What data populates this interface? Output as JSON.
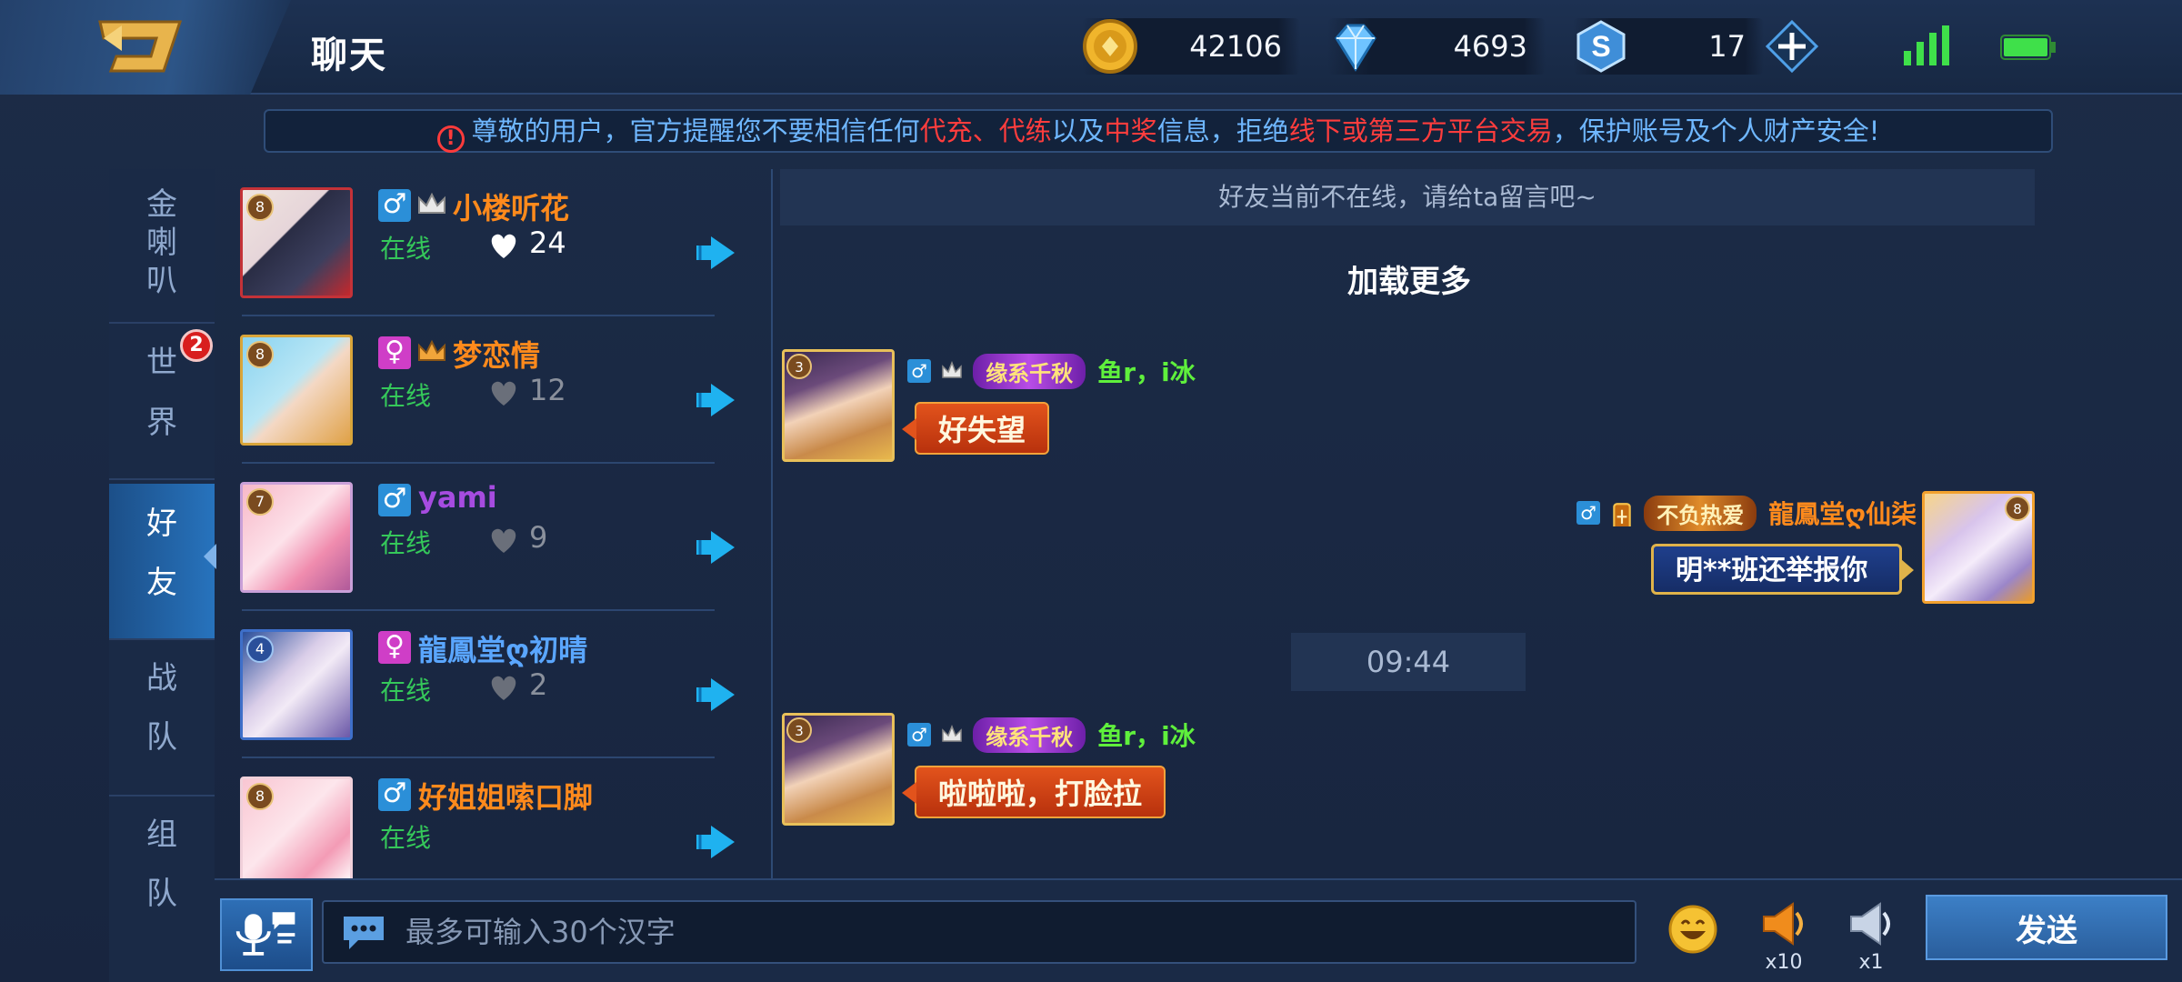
{
  "header": {
    "title": "聊天",
    "gold": "42106",
    "diamonds": "4693",
    "vouchers": "17"
  },
  "notice": {
    "p1": "尊敬的用户，官方提醒您不要相信任何",
    "r1": "代充、代练",
    "p2": "以及",
    "r2": "中奖",
    "p3": "信息，拒绝",
    "r3": "线下或第三方平台交易",
    "p4": "，保护账号及个人财产安全!"
  },
  "tabs": [
    {
      "chars": [
        "金",
        "喇",
        "叭"
      ]
    },
    {
      "chars": [
        "世",
        "界"
      ],
      "badge": "2"
    },
    {
      "chars": [
        "好",
        "友"
      ]
    },
    {
      "chars": [
        "战",
        "队"
      ]
    },
    {
      "chars": [
        "组",
        "队"
      ]
    }
  ],
  "friends": [
    {
      "gender": "♂",
      "name": "小楼听花",
      "status": "在线",
      "hearts": "24",
      "level": "8"
    },
    {
      "gender": "♀",
      "name": "梦恋情",
      "status": "在线",
      "hearts": "12",
      "level": "8"
    },
    {
      "gender": "♂",
      "name": "yami",
      "status": "在线",
      "hearts": "9",
      "level": "7"
    },
    {
      "gender": "♀",
      "name": "龍鳳堂ღ初晴",
      "status": "在线",
      "hearts": "2",
      "level": "4"
    },
    {
      "gender": "♂",
      "name": "好姐姐嗦口脚",
      "status": "在线",
      "level": "8"
    }
  ],
  "chat": {
    "offline_notice": "好友当前不在线，请给ta留言吧~",
    "load_more": "加载更多",
    "messages": [
      {
        "gender": "♂",
        "tag": "缘系千秋",
        "name": "鱼r，i冰",
        "text": "好失望",
        "level": "3"
      },
      {
        "gender": "♂",
        "tag": "不负热爱",
        "name": "龍鳳堂ღ仙柒",
        "text": "明**班还举报你",
        "level": "8"
      },
      {
        "gender": "♂",
        "tag": "缘系千秋",
        "name": "鱼r，i冰",
        "text": "啦啦啦，打脸拉",
        "level": "3"
      }
    ],
    "timestamp": "09:44"
  },
  "input": {
    "placeholder": "最多可输入30个汉字",
    "horn_big_count": "x10",
    "horn_small_count": "x1",
    "send_label": "发送"
  },
  "colors": {
    "male": "#2b8fd8",
    "female": "#cf3ec7",
    "online": "#35c85a",
    "name_orange": "#ff8a1c",
    "name_purple": "#a64ce0",
    "name_blue": "#5aa6ff",
    "name_green": "#5ff03c",
    "warning_red": "#ff3d3d"
  }
}
